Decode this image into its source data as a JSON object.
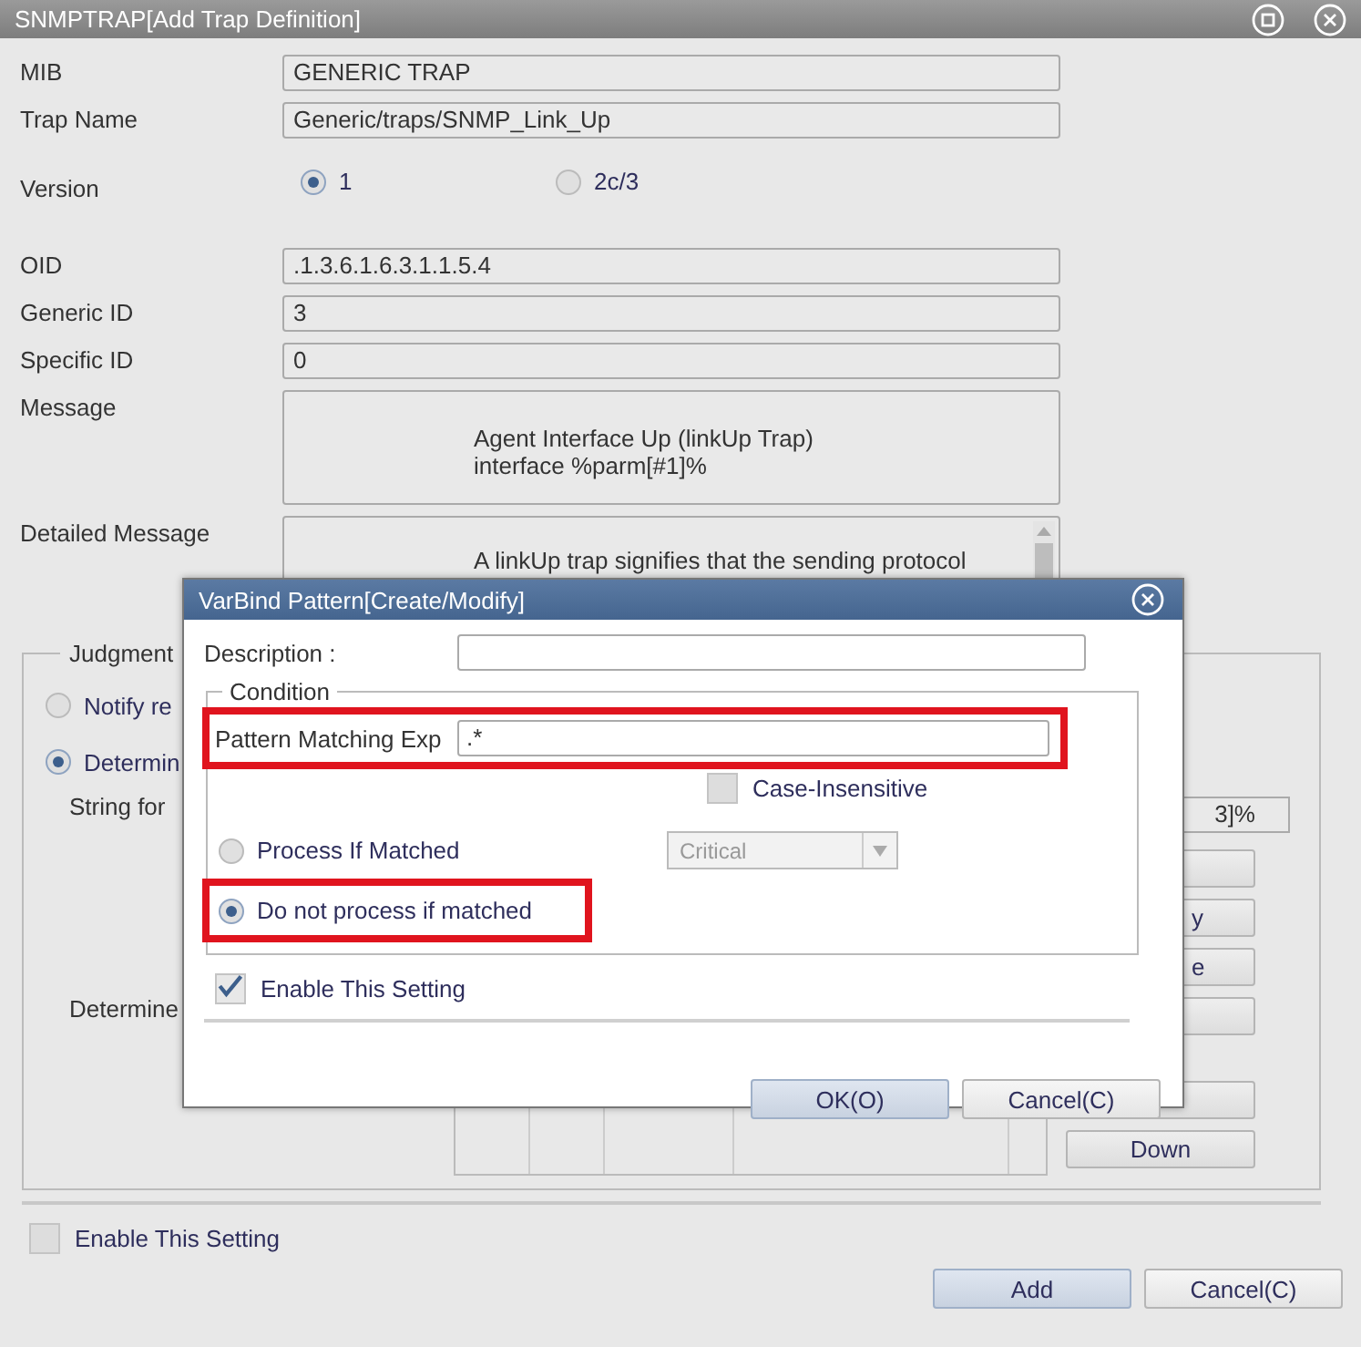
{
  "window": {
    "title": "SNMPTRAP[Add Trap Definition]"
  },
  "fields": [
    {
      "label": "MIB",
      "value": "GENERIC TRAP",
      "kind": "text"
    },
    {
      "label": "Trap Name",
      "value": "Generic/traps/SNMP_Link_Up",
      "kind": "text"
    },
    {
      "label": "Version",
      "kind": "radio",
      "options": [
        {
          "label": "1",
          "selected": true
        },
        {
          "label": "2c/3",
          "selected": false
        }
      ]
    },
    {
      "label": "OID",
      "value": ".1.3.6.1.6.3.1.1.5.4",
      "kind": "text"
    },
    {
      "label": "Generic ID",
      "value": "3",
      "kind": "text"
    },
    {
      "label": "Specific ID",
      "value": "0",
      "kind": "text"
    },
    {
      "label": "Message",
      "lines": [
        "Agent Interface Up (linkUp Trap)",
        "interface %parm[#1]%"
      ],
      "kind": "multiline"
    },
    {
      "label": "Detailed Message",
      "lines": [
        "A linkUp trap signifies that the sending protocol"
      ],
      "kind": "scrolling"
    }
  ],
  "judgment": {
    "legend": "Judgment",
    "options": [
      {
        "label": "Notify re",
        "selected": false
      },
      {
        "label": "Determin",
        "selected": true
      }
    ],
    "string_label": "String for",
    "string_value": "3]%",
    "determine_label": "Determine",
    "side_buttons": [
      {
        "kind": "blank"
      },
      {
        "kind": "cut",
        "label": "y"
      },
      {
        "kind": "cut",
        "label": "e"
      },
      {
        "kind": "blank"
      },
      {
        "kind": "blank"
      },
      {
        "kind": "text",
        "label": "Down"
      }
    ]
  },
  "enable": {
    "label": "Enable This Setting",
    "checked": false
  },
  "buttons": [
    {
      "label": "Add",
      "kind": "primary"
    },
    {
      "label": "Cancel(C)",
      "kind": "normal"
    }
  ],
  "dialog": {
    "title": "VarBind Pattern[Create/Modify]",
    "description_label": "Description :",
    "condition": {
      "legend": "Condition",
      "pattern_label": "Pattern Matching Exp",
      "pattern_value": ".*",
      "pattern_highlighted": true,
      "case_insensitive": {
        "label": "Case-Insensitive",
        "checked": false
      },
      "options": [
        {
          "label": "Process If Matched",
          "selected": false,
          "highlighted": false
        },
        {
          "label": "Do not process if matched",
          "selected": true,
          "highlighted": true
        }
      ],
      "severity": {
        "value": "Critical",
        "disabled": true
      }
    },
    "enable": {
      "label": "Enable This Setting",
      "checked": true
    },
    "buttons": [
      {
        "label": "OK(O)",
        "kind": "primary"
      },
      {
        "label": "Cancel(C)",
        "kind": "normal"
      }
    ]
  }
}
